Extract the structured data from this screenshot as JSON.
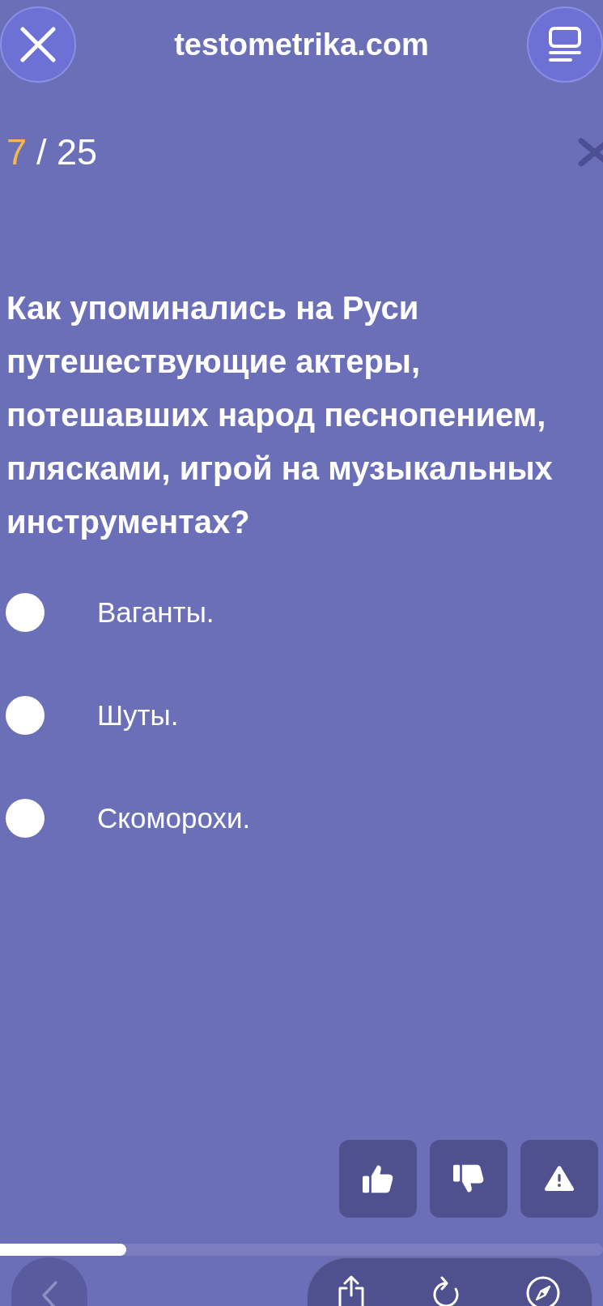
{
  "header": {
    "title": "testometrika.com"
  },
  "counter": {
    "current": "7",
    "total": "/ 25"
  },
  "question": {
    "text": "Как упоминались на Руси путешествующие актеры, потешавших народ песнопением, плясками, игрой на музыкальных инструментах?"
  },
  "answers": [
    {
      "label": "Ваганты.",
      "selected": false
    },
    {
      "label": "Шуты.",
      "selected": false
    },
    {
      "label": "Скоморохи.",
      "selected": false
    }
  ],
  "progress_bar": {
    "level": 0.21
  },
  "browser_toolbar": {
    "back_disabled": true
  }
}
